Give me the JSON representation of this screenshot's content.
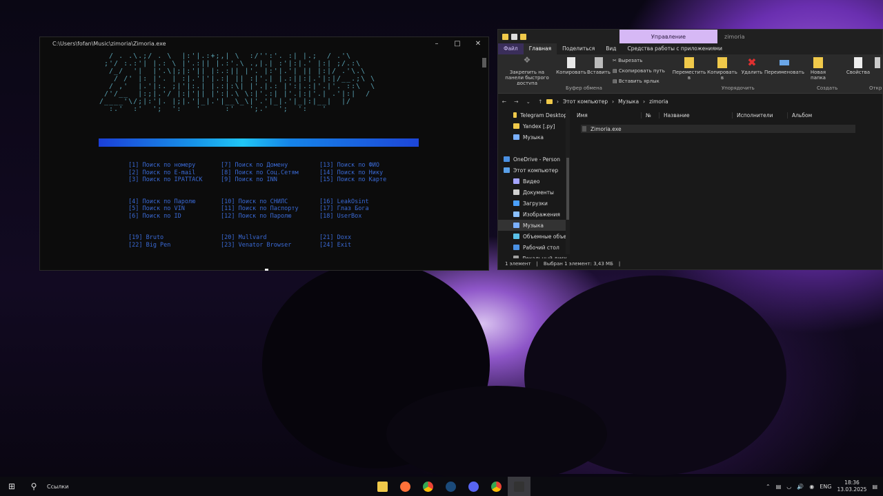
{
  "console": {
    "title": "C:\\Users\\fofan\\Music\\zimoria\\Zimoria.exe",
    "ascii": "  / . .\\.;/ . \\  |:'|.:+;,| \\  :/'':'. :| |.;  / .'\\\n ;'/ :.:'| |.: \\ |'.:|| |.:'.\\ .,|.| :'|:|.' |:| ;/.:\\\n  /_/  '|  |'.\\|;|:'|| |:.:|| |'. |:'|.'| || |:|/ .'\\.\\\n   / /' |: |'. | :|.'|'|.:| || :|'.| |.:||:|.'|:|/__.;\\ \\\n  / ,'  |.'|:. ;|'|:.| |.:|:\\| |'.|.: |':|.:|'.|'. ::\\  \\\n /'/__  |:;|.'/ |:|'|| |':|.\\ \\:|'.:| |'.|:|'.| .'|:|  /\n/____'\\/;|:'|. |;|.'|_|.'|__\\_\\|'.'|_|.'|_|:|__|  |/\n  :.'  :'  ';  ':   '     :'   ';.'  ';  ':   '",
    "menu_col1": "[1] Поиск по номеру\n[2] Поиск по E-mail\n[3] Поиск по IPATTACK\n\n\n[4] Поиск по Паролю\n[5] Поиск по VIN\n[6] Поиск по ID\n\n\n[19] Bruto\n[22] Big Pen",
    "menu_col2": "[7] Поиск по Домену\n[8] Поиск по Соц.Сетям\n[9] Поиск по INN\n\n\n[10] Поиск по СНИЛС\n[11] Поиск по Паспорту\n[12] Поиск по Паролю\n\n\n[20] Mullvard\n[23] Venator Browser",
    "menu_col3": "[13] Поиск по ФИО\n[14] Поиск по Нику\n[15] Поиск по Карте\n\n\n[16] LeakOsint\n[17] Глаз Бога\n[18] UserBox\n\n\n[21] Doxx\n[24] Exit"
  },
  "explorer": {
    "manage_tab": "Управление",
    "window_title": "zimoria",
    "ribbon_tabs": [
      "Файл",
      "Главная",
      "Поделиться",
      "Вид",
      "Средства работы с приложениями"
    ],
    "ribbon": {
      "pin": "Закрепить на панели быстрого доступа",
      "copy": "Копировать",
      "paste": "Вставить",
      "cut": "Вырезать",
      "copy_path": "Скопировать путь",
      "paste_shortcut": "Вставить ярлык",
      "move": "Переместить в",
      "copy_to": "Копировать в",
      "delete": "Удалить",
      "rename": "Переименовать",
      "new_folder": "Новая папка",
      "properties": "Свойства",
      "open": "Откр"
    },
    "groups": [
      "Буфер обмена",
      "Упорядочить",
      "Создать",
      "Откр"
    ],
    "breadcrumb": [
      "Этот компьютер",
      "Музыка",
      "zimoria"
    ],
    "nav_items": [
      {
        "label": "Telegram Desktop",
        "color": "#f0c94a"
      },
      {
        "label": "Yandex [.py]",
        "color": "#f0c94a"
      },
      {
        "label": "Музыка",
        "color": "#7ab0ff"
      },
      {
        "label": "",
        "color": ""
      },
      {
        "label": "OneDrive - Person",
        "color": "#4a90e2"
      },
      {
        "label": "Этот компьютер",
        "color": "#5aa0e8"
      },
      {
        "label": "Видео",
        "color": "#a4a4ff"
      },
      {
        "label": "Документы",
        "color": "#d0d0d0"
      },
      {
        "label": "Загрузки",
        "color": "#4aa0ff"
      },
      {
        "label": "Изображения",
        "color": "#8ac0ff"
      },
      {
        "label": "Музыка",
        "color": "#7ab0ff"
      },
      {
        "label": "Объемные объе",
        "color": "#5ac0e8"
      },
      {
        "label": "Рабочий стол",
        "color": "#4a90e2"
      },
      {
        "label": "Локальный диск",
        "color": "#a0a0a0"
      }
    ],
    "columns": [
      "Имя",
      "№",
      "Название",
      "Исполнители",
      "Альбом"
    ],
    "file_name": "Zimoria.exe",
    "status_count": "1 элемент",
    "status_selected": "Выбран 1 элемент: 3,43 МБ"
  },
  "taskbar": {
    "links": "Ссылки",
    "lang": "ENG",
    "time": "18:36",
    "date": "13.03.2025"
  }
}
